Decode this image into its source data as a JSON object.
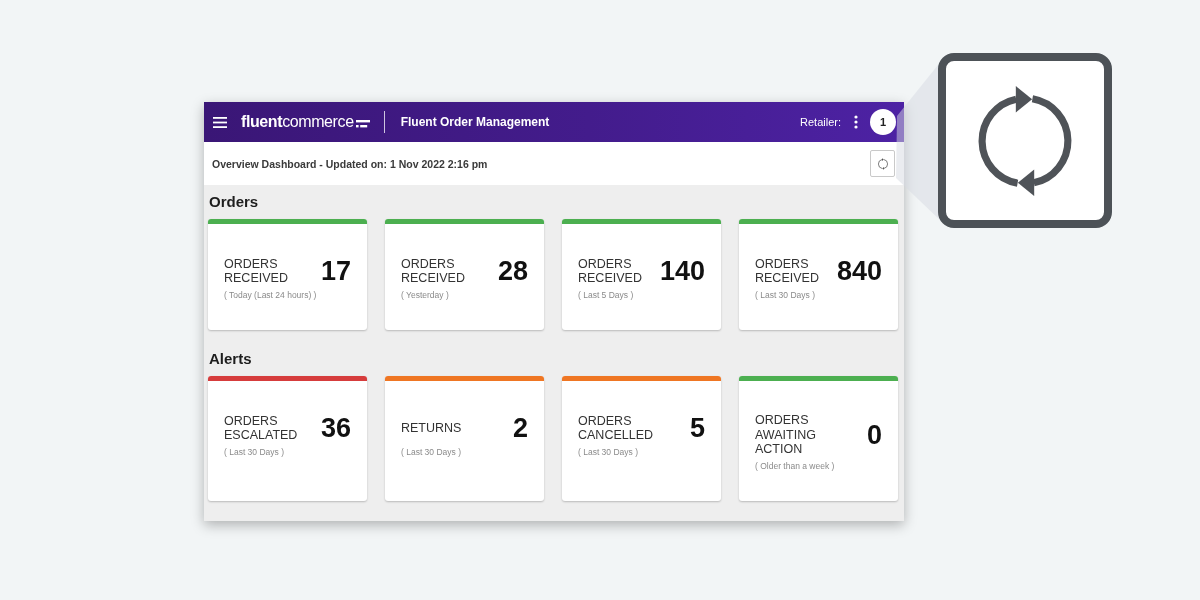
{
  "header": {
    "logo": "**fluent**commerce",
    "title": "Fluent Order Management",
    "retailer_label": "Retailer:",
    "badge": "1"
  },
  "toolbar": {
    "title": "Overview Dashboard - Updated on: 1 Nov 2022 2:16 pm"
  },
  "sections": [
    {
      "title": "Orders",
      "cards": [
        {
          "label": "ORDERS RECEIVED",
          "value": "17",
          "period": "( Today (Last 24 hours) )",
          "color": "#4caf50"
        },
        {
          "label": "ORDERS RECEIVED",
          "value": "28",
          "period": "( Yesterday )",
          "color": "#4caf50"
        },
        {
          "label": "ORDERS RECEIVED",
          "value": "140",
          "period": "( Last 5 Days )",
          "color": "#4caf50"
        },
        {
          "label": "ORDERS RECEIVED",
          "value": "840",
          "period": "( Last 30 Days )",
          "color": "#4caf50"
        }
      ]
    },
    {
      "title": "Alerts",
      "cards": [
        {
          "label": "ORDERS ESCALATED",
          "value": "36",
          "period": "( Last 30 Days )",
          "color": "#d63c3c"
        },
        {
          "label": "RETURNS",
          "value": "2",
          "period": "( Last 30 Days )",
          "color": "#ef7623"
        },
        {
          "label": "ORDERS CANCELLED",
          "value": "5",
          "period": "( Last 30 Days )",
          "color": "#ef7623"
        },
        {
          "label": "ORDERS AWAITING ACTION",
          "value": "0",
          "period": "( Older than a week )",
          "color": "#4caf50"
        }
      ]
    }
  ]
}
